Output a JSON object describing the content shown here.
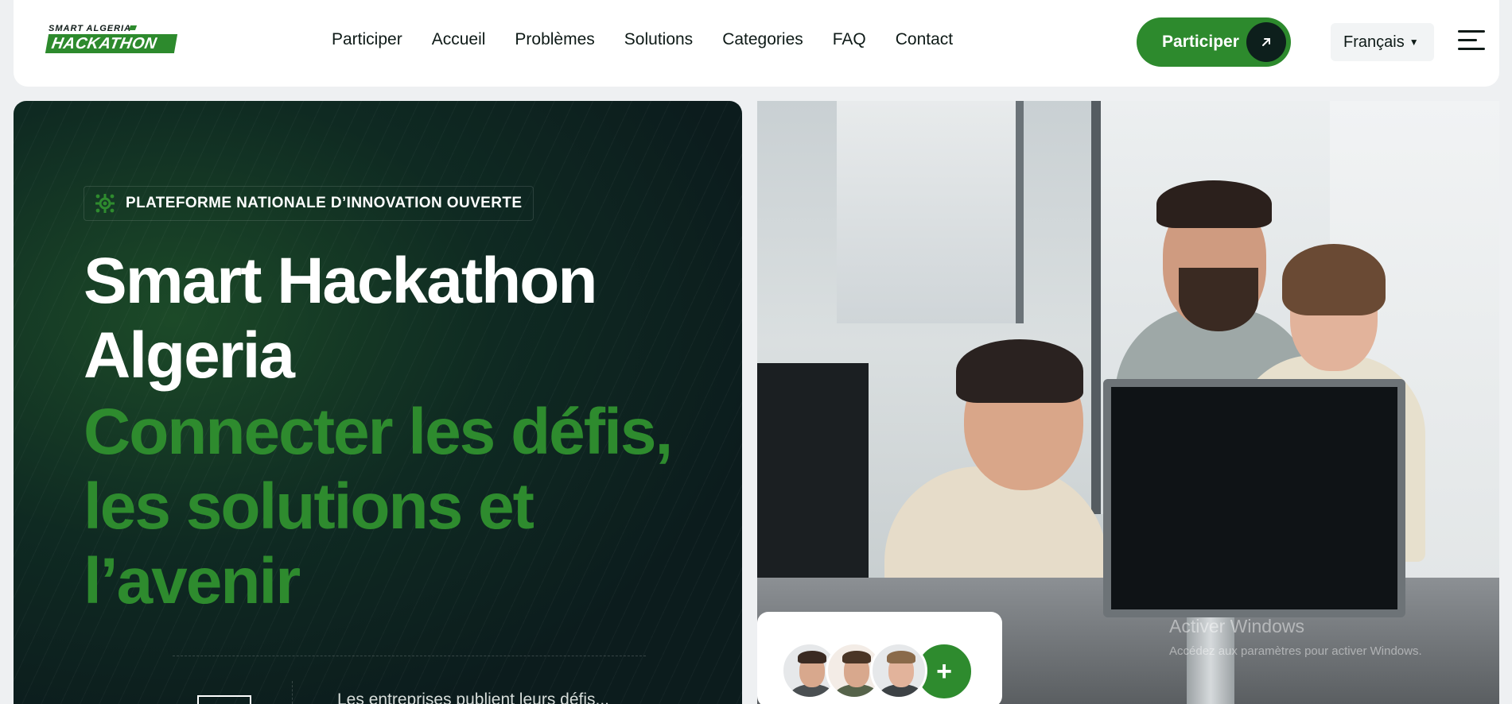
{
  "header": {
    "logo": {
      "top_text": "SMART ALGERIA",
      "main_text": "HACKATHON"
    },
    "nav": [
      {
        "label": "Participer"
      },
      {
        "label": "Accueil"
      },
      {
        "label": "Problèmes"
      },
      {
        "label": "Solutions"
      },
      {
        "label": "Categories"
      },
      {
        "label": "FAQ"
      },
      {
        "label": "Contact"
      }
    ],
    "cta_label": "Participer",
    "cta_icon": "arrow-up-right-icon",
    "language": "Français",
    "menu_icon": "hamburger-menu-icon"
  },
  "hero": {
    "badge": "PLATEFORME NATIONALE D’INNOVATION OUVERTE",
    "badge_icon": "gear-network-icon",
    "title_line1": "Smart Hackathon",
    "title_line2": "Algeria",
    "subtitle_line1": "Connecter les défis,",
    "subtitle_line2": "les solutions et",
    "subtitle_line3": "l’avenir",
    "description": "Les entreprises publient leurs défis..."
  },
  "overlay": {
    "watermark_title": "Activer Windows",
    "watermark_sub": "Accédez aux paramètres pour activer Windows."
  },
  "avatar_card": {
    "plus_label": "+"
  },
  "colors": {
    "brand_green": "#2d8a2d",
    "dark_bg": "#0c1c1d",
    "white": "#ffffff"
  }
}
